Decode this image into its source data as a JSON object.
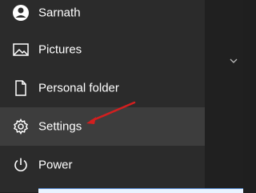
{
  "menu": {
    "items": [
      {
        "label": "Sarnath"
      },
      {
        "label": "Pictures"
      },
      {
        "label": "Personal folder"
      },
      {
        "label": "Settings"
      },
      {
        "label": "Power"
      }
    ]
  },
  "colors": {
    "menu_bg": "#2b2b2b",
    "hover_bg": "#3d3d3d",
    "text": "#ffffff",
    "annotation_arrow": "#d21f1f"
  },
  "icons": [
    "user-avatar-icon",
    "pictures-icon",
    "document-icon",
    "gear-icon",
    "power-icon",
    "chevron-down-icon"
  ]
}
